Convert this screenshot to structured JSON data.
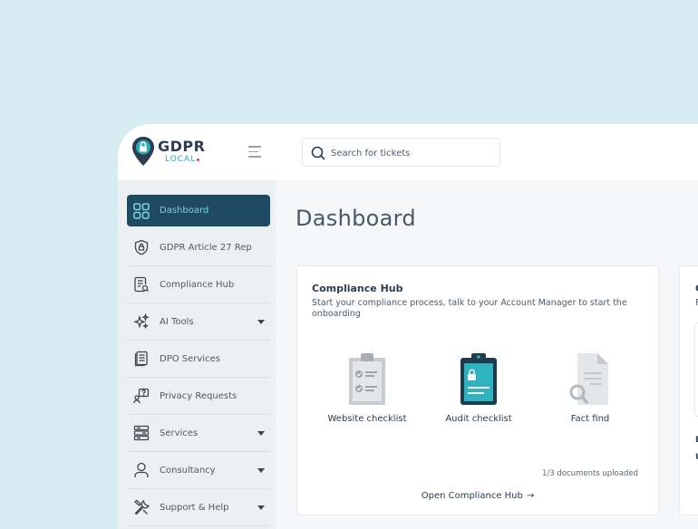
{
  "brand": {
    "name": "GDPR",
    "tagline": "LOCAL"
  },
  "search": {
    "placeholder": "Search for tickets"
  },
  "sidebar": {
    "items": [
      {
        "label": "Dashboard",
        "icon": "dashboard-grid-icon",
        "active": true
      },
      {
        "label": "GDPR Article 27 Rep",
        "icon": "shield-lock-icon"
      },
      {
        "label": "Compliance Hub",
        "icon": "document-search-icon"
      },
      {
        "label": "AI Tools",
        "icon": "sparkle-icon",
        "expandable": true
      },
      {
        "label": "DPO Services",
        "icon": "documents-icon"
      },
      {
        "label": "Privacy Requests",
        "icon": "question-chat-icon"
      },
      {
        "label": "Services",
        "icon": "server-stack-icon",
        "expandable": true
      },
      {
        "label": "Consultancy",
        "icon": "user-icon",
        "expandable": true
      },
      {
        "label": "Support & Help",
        "icon": "tools-icon",
        "expandable": true
      }
    ]
  },
  "page": {
    "title": "Dashboard"
  },
  "compliance_hub": {
    "title": "Compliance Hub",
    "description": "Start your compliance process, talk to your Account Manager to start the onboarding",
    "documents": [
      {
        "label": "Website checklist",
        "icon": "clipboard-checklist-icon"
      },
      {
        "label": "Audit checklist",
        "icon": "clipboard-lock-icon"
      },
      {
        "label": "Fact find",
        "icon": "file-search-icon"
      }
    ],
    "upload_status": "1/3 documents uploaded",
    "open_link": "Open Compliance Hub",
    "open_arrow": "→"
  },
  "second_card": {
    "title_fragment": "C",
    "subtitle_fragment": "F",
    "line1_fragment": "E",
    "line2_fragment": "U"
  },
  "colors": {
    "background": "#d5ecf0",
    "sidebar_active": "#1e4a64",
    "active_label": "#7fd3de",
    "accent_teal": "#2aaab5",
    "logo_dot": "#e7453b"
  }
}
